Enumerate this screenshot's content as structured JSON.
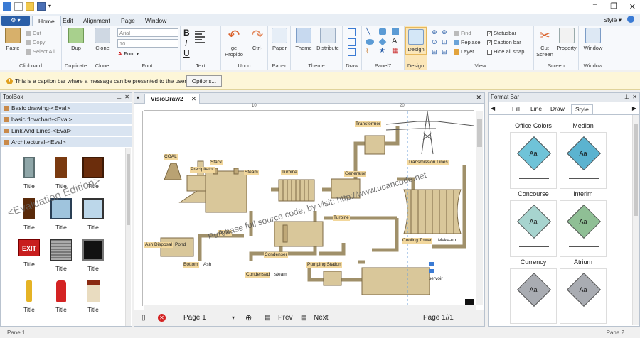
{
  "app": {
    "style_menu": "Style",
    "tabs": [
      "Home",
      "Edit",
      "Alignment",
      "Page",
      "Window"
    ]
  },
  "ribbon": {
    "clipboard": {
      "label": "Clipboard",
      "paste": "Paste",
      "cut": "Cut",
      "copy": "Copy",
      "select_all": "Select All"
    },
    "duplicate": {
      "label": "Duplicate",
      "dup": "Dup"
    },
    "clone": {
      "label": "Clone",
      "clone": "Clone"
    },
    "font": {
      "label": "Font",
      "family": "Arial",
      "size": "10",
      "font_button": "Font"
    },
    "text": {
      "label": "Text"
    },
    "undo": {
      "label": "Undo",
      "undo_btn": "ge Propido",
      "redo_btn": "Ctrl-"
    },
    "paper": {
      "label": "Paper",
      "paper": "Paper"
    },
    "theme": {
      "label": "Theme",
      "theme": "Theme",
      "distribute": "Distribute"
    },
    "draw": {
      "label": "Draw"
    },
    "panel7": {
      "label": "Panel7"
    },
    "design": {
      "label": "Design",
      "design": "Design"
    },
    "view": {
      "label": "View",
      "find": "Find",
      "replace": "Replace",
      "layer": "Layer",
      "statusbar": "Statusbar",
      "caption_bar": "Caption bar",
      "hide_all_snap": "Hide all snap"
    },
    "screen": {
      "label": "Screen",
      "cut_screen_1": "Cut",
      "cut_screen_2": "Screen",
      "property": "Property"
    },
    "window": {
      "label": "Window",
      "window": "Window"
    }
  },
  "caption_bar": {
    "message": "This is a caption bar where a message can be presented to the user.",
    "options_button": "Options..."
  },
  "toolbox": {
    "title": "ToolBox",
    "categories": [
      "Basic drawing-<Eval>",
      "basic flowchart-<Eval>",
      "Link And Lines-<Eval>",
      "Architectural-<Eval>"
    ],
    "item_label": "Title",
    "watermark": "<Evaluation Edition>"
  },
  "document": {
    "tab_title": "VisioDraw2",
    "ruler_marks": [
      "10",
      "20"
    ],
    "watermark": "Purchase full source code, by visit: http://www.ucancode.net",
    "labels": {
      "coal": "COAL",
      "stack": "Stack",
      "precipitator": "Precipitator",
      "steam": "Steam",
      "turbine": "Turbine",
      "generator": "Generator",
      "transformer": "Transformer",
      "transmission_lines": "Transmission Lines",
      "turbine2": "Turbine",
      "boiler": "Boiler",
      "ash_disposal": "Ash Disposal",
      "pond": "Pond",
      "bottom": "Bottom",
      "ash": "Ash",
      "condenser": "Condenser",
      "condensed": "Condensed",
      "steam2": "steam",
      "pumping_station": "Pumping Station",
      "cooling_tower": "Cooling Tower",
      "make_up": "Make-up",
      "reservoir": "servoir"
    }
  },
  "navigation": {
    "page_label": "Page",
    "page_value": "1",
    "prev": "Prev",
    "next": "Next",
    "page_count": "Page 1//1"
  },
  "format_bar": {
    "title": "Format Bar",
    "tabs": [
      "Fill",
      "Line",
      "Draw",
      "Style"
    ],
    "styles": [
      {
        "name": "Office Colors",
        "color": "#6fc3d8"
      },
      {
        "name": "Median",
        "color": "#5bb3d0"
      },
      {
        "name": "Concourse",
        "color": "#a7d4cf"
      },
      {
        "name": "interim",
        "color": "#8fbf95"
      },
      {
        "name": "Currency",
        "color": "#a9acb2"
      },
      {
        "name": "Atrium",
        "color": "#a9acb2"
      }
    ],
    "sample_text": "Aa"
  },
  "status": {
    "pane1": "Pane 1",
    "pane2": "Pane 2"
  }
}
